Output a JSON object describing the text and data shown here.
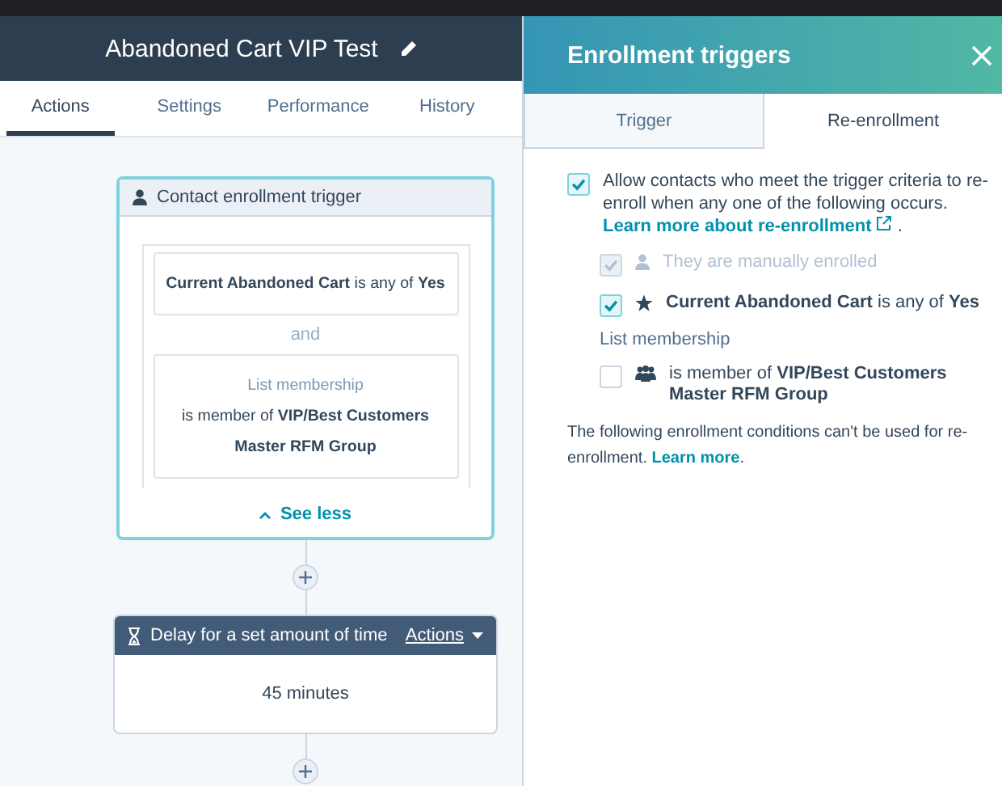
{
  "workflow": {
    "title": "Abandoned Cart VIP Test",
    "tabs": [
      {
        "label": "Actions",
        "selected": true
      },
      {
        "label": "Settings",
        "selected": false
      },
      {
        "label": "Performance",
        "selected": false
      },
      {
        "label": "History",
        "selected": false
      }
    ]
  },
  "trigger_card": {
    "title": "Contact enrollment trigger",
    "filters": [
      {
        "kind": "property",
        "text": "**Current Abandoned Cart** is any of **Yes**"
      },
      {
        "kind": "list",
        "label": "List membership",
        "text": "is member of **VIP/Best Customers Master RFM Group**"
      }
    ],
    "joiner": "and",
    "toggle": "See less"
  },
  "steps": [
    {
      "kind": "delay",
      "title": "Delay for a set amount of time",
      "menu": "Actions",
      "body": "45 minutes"
    }
  ],
  "panel": {
    "title": "Enrollment triggers",
    "tabs": [
      {
        "label": "Trigger",
        "selected": false
      },
      {
        "label": "Re-enrollment",
        "selected": true
      }
    ],
    "allow": {
      "checked": true,
      "text": "Allow contacts who meet the trigger criteria to re-enroll when any one of the following occurs.",
      "link": "Learn more about re-enrollment",
      "after": " ."
    },
    "options": [
      {
        "kind": "manual",
        "checked": true,
        "disabled": true,
        "text": "They are manually enrolled"
      },
      {
        "kind": "property",
        "checked": true,
        "disabled": false,
        "text": "**Current Abandoned Cart** is any of **Yes**"
      },
      {
        "kind": "heading",
        "text": "List membership"
      },
      {
        "kind": "list",
        "checked": false,
        "disabled": false,
        "text": "is member of **VIP/Best Customers Master RFM Group**"
      }
    ],
    "note": {
      "text": "The following enrollment conditions can't be used for re-enrollment.",
      "link": "Learn more",
      "after": "."
    }
  }
}
